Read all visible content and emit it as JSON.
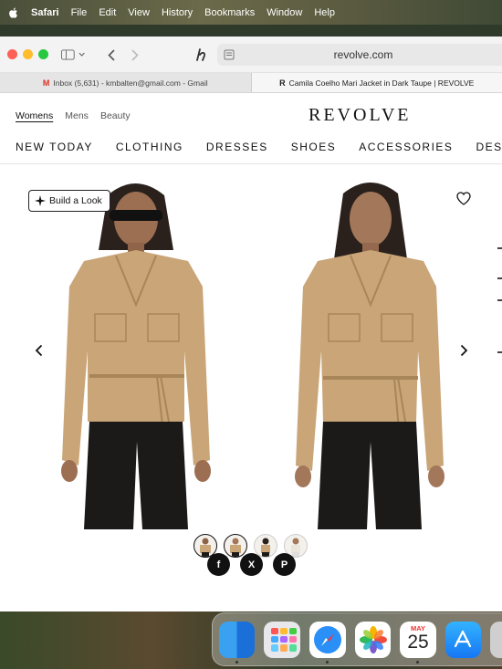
{
  "menubar": {
    "app": "Safari",
    "items": [
      "File",
      "Edit",
      "View",
      "History",
      "Bookmarks",
      "Window",
      "Help"
    ]
  },
  "browser": {
    "url": "revolve.com",
    "tabs": [
      {
        "favicon": "M",
        "title": "Inbox (5,631) - kmbalten@gmail.com - Gmail"
      },
      {
        "favicon": "R",
        "title": "Camila Coelho Mari Jacket in Dark Taupe | REVOLVE"
      }
    ]
  },
  "site": {
    "gender": [
      "Womens",
      "Mens",
      "Beauty"
    ],
    "logo": "REVOLVE",
    "nav": [
      "NEW TODAY",
      "CLOTHING",
      "DRESSES",
      "SHOES",
      "ACCESSORIES",
      "DESIGN"
    ]
  },
  "product": {
    "build_look": "Build a Look",
    "jacket_color": "#c9a577",
    "pants_color": "#1c1a19"
  },
  "share": [
    "f",
    "X",
    "P"
  ],
  "dock": {
    "calendar_month": "MAY",
    "calendar_day": "25"
  }
}
